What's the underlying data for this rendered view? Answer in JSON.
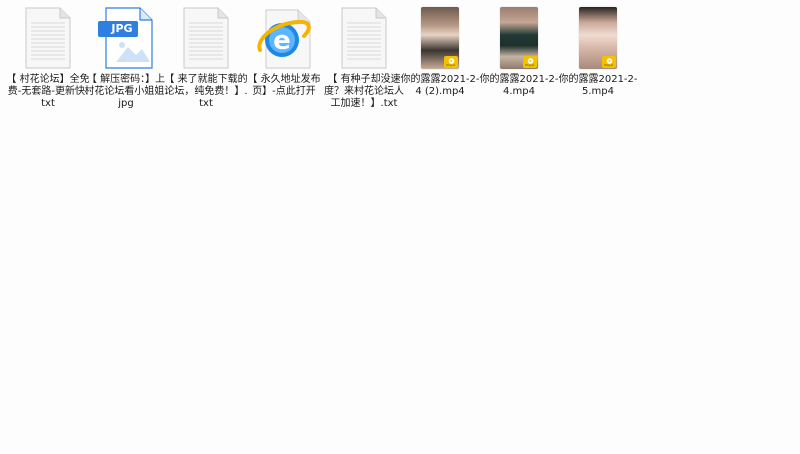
{
  "files": [
    {
      "name": "【 村花论坛】全免费-无套路-更新快.txt",
      "icon": "text-document-icon"
    },
    {
      "name": "【 解压密码：】上村花论坛看小姐姐.jpg",
      "icon": "jpg-image-icon",
      "badge": "JPG"
    },
    {
      "name": "【 来了就能下载的论坛，纯免费！】.txt",
      "icon": "text-document-icon"
    },
    {
      "name": "【 永久地址发布页】-点此打开",
      "icon": "internet-explorer-icon"
    },
    {
      "name": "【 有种子却没速度？来村花论坛人工加速！】.txt",
      "icon": "text-document-icon"
    },
    {
      "name": "你的露露2021-2-4 (2).mp4",
      "icon": "video-thumbnail-icon",
      "badge": "Player"
    },
    {
      "name": "你的露露2021-2-4.mp4",
      "icon": "video-thumbnail-icon",
      "badge": "Player"
    },
    {
      "name": "你的露露2021-2-5.mp4",
      "icon": "video-thumbnail-icon",
      "badge": "Player"
    }
  ],
  "colors": {
    "jpg_blue": "#2f7fe0",
    "ie_blue": "#1e88e5",
    "ie_ring": "#f5b400",
    "play_badge": "#f2c200"
  }
}
